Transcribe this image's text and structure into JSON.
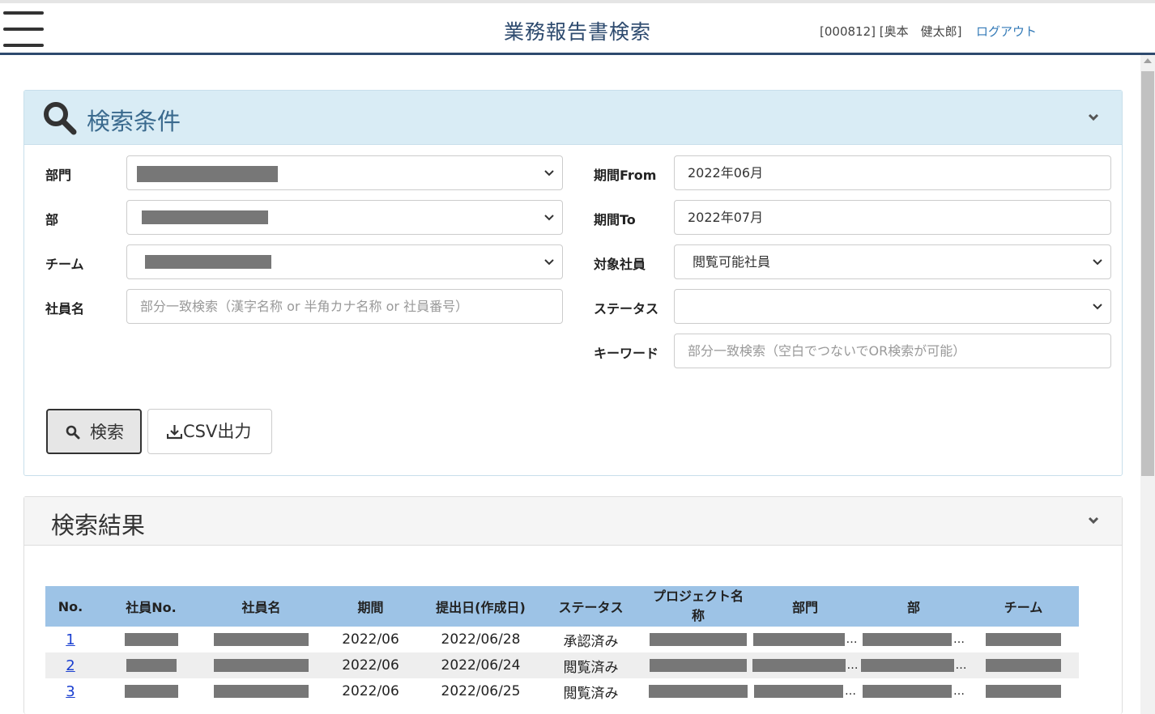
{
  "header": {
    "title": "業務報告書検索",
    "user": "[000812] [奥本　健太郎]",
    "logout": "ログアウト"
  },
  "search_panel": {
    "title": "検索条件",
    "fields": {
      "department_label": "部門",
      "division_label": "部",
      "team_label": "チーム",
      "employee_name_label": "社員名",
      "employee_name_placeholder": "部分一致検索（漢字名称 or 半角カナ名称 or 社員番号）",
      "period_from_label": "期間From",
      "period_from_value": "2022年06月",
      "period_to_label": "期間To",
      "period_to_value": "2022年07月",
      "target_employee_label": "対象社員",
      "target_employee_value": "閲覧可能社員",
      "status_label": "ステータス",
      "status_value": "",
      "keyword_label": "キーワード",
      "keyword_placeholder": "部分一致検索（空白でつないでOR検索が可能）"
    },
    "search_button": "検索",
    "csv_button": "CSV出力"
  },
  "result_panel": {
    "title": "検索結果",
    "columns": [
      "No.",
      "社員No.",
      "社員名",
      "期間",
      "提出日(作成日)",
      "ステータス",
      "プロジェクト名称",
      "部門",
      "部",
      "チーム"
    ],
    "rows": [
      {
        "no": "1",
        "period": "2022/06",
        "submitted": "2022/06/28",
        "status": "承認済み"
      },
      {
        "no": "2",
        "period": "2022/06",
        "submitted": "2022/06/24",
        "status": "閲覧済み"
      },
      {
        "no": "3",
        "period": "2022/06",
        "submitted": "2022/06/25",
        "status": "閲覧済み"
      }
    ]
  },
  "colors": {
    "header_border": "#2d4a6e",
    "search_head_bg": "#d9ecf5",
    "table_head_bg": "#9dc3e6",
    "link": "#1a3fd0"
  }
}
